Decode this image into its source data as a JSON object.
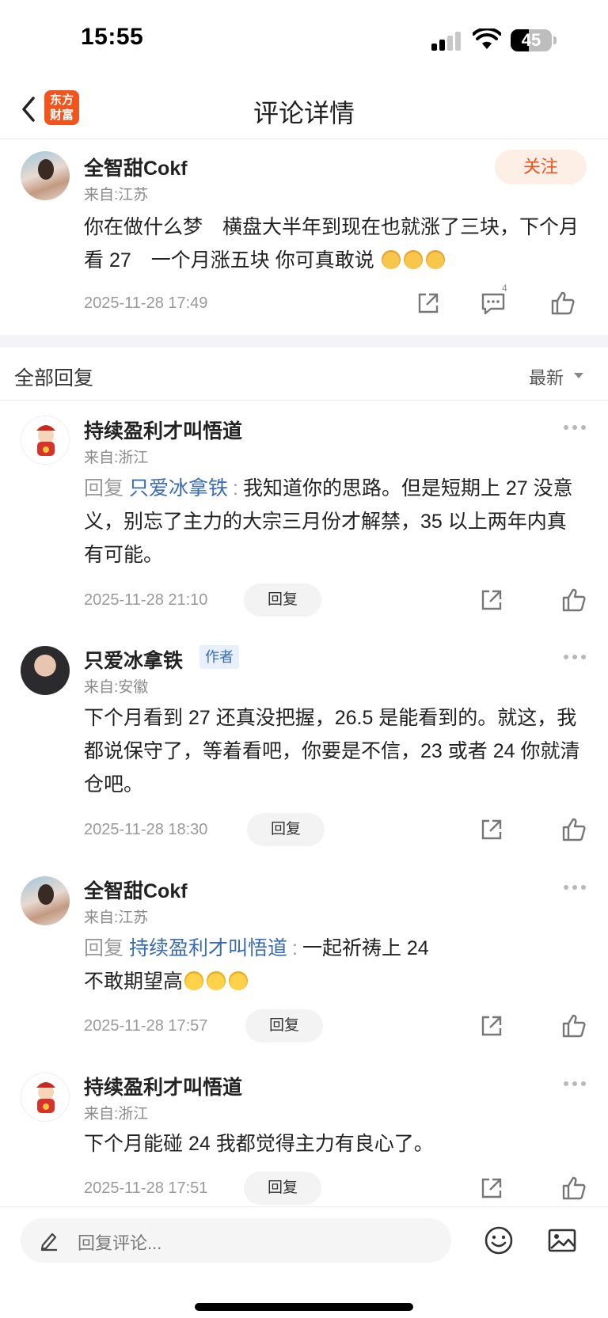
{
  "status_bar": {
    "time": "15:55",
    "battery": "45",
    "battery_level": 0.45
  },
  "nav": {
    "title": "评论详情",
    "logo_line1": "东方",
    "logo_line2": "财富"
  },
  "main_comment": {
    "username": "全智甜Cokf",
    "location": "来自:江苏",
    "follow_label": "关注",
    "text": "你在做什么梦　横盘大半年到现在也就涨了三块，下个月看 27　一个月涨五块 你可真敢说",
    "emojis": [
      "cat-emoji",
      "cat-emoji",
      "cat-emoji"
    ],
    "timestamp": "2025-11-28 17:49",
    "comment_count": "4"
  },
  "replies_header": {
    "title": "全部回复",
    "sort_label": "最新"
  },
  "replies": [
    {
      "username": "持续盈利才叫悟道",
      "location": "来自:浙江",
      "reply_prefix": "回复",
      "reply_target": "只爱冰拿铁",
      "reply_colon": ":",
      "text": "我知道你的思路。但是短期上 27 没意义，别忘了主力的大宗三月份才解禁，35 以上两年内真有可能。",
      "timestamp": "2025-11-28 21:10",
      "reply_button": "回复"
    },
    {
      "username": "只爱冰拿铁",
      "badge": "作者",
      "location": "来自:安徽",
      "text": "下个月看到 27 还真没把握，26.5 是能看到的。就这，我都说保守了，等着看吧，你要是不信，23 或者 24 你就清仓吧。",
      "timestamp": "2025-11-28 18:30",
      "reply_button": "回复"
    },
    {
      "username": "全智甜Cokf",
      "location": "来自:江苏",
      "reply_prefix": "回复",
      "reply_target": "持续盈利才叫悟道",
      "reply_colon": ":",
      "text_line1": "一起祈祷上 24",
      "text_line2": "不敢期望高",
      "emojis": [
        "laugh-emoji",
        "laugh-emoji",
        "laugh-emoji"
      ],
      "timestamp": "2025-11-28 17:57",
      "reply_button": "回复"
    },
    {
      "username": "持续盈利才叫悟道",
      "location": "来自:浙江",
      "text": "下个月能碰 24 我都觉得主力有良心了。",
      "timestamp": "2025-11-28 17:51",
      "reply_button": "回复"
    }
  ],
  "bottom_bar": {
    "placeholder": "回复评论..."
  },
  "colors": {
    "accent": "#f2541d",
    "link": "#3a6bb5",
    "muted": "#9a9a9a"
  }
}
